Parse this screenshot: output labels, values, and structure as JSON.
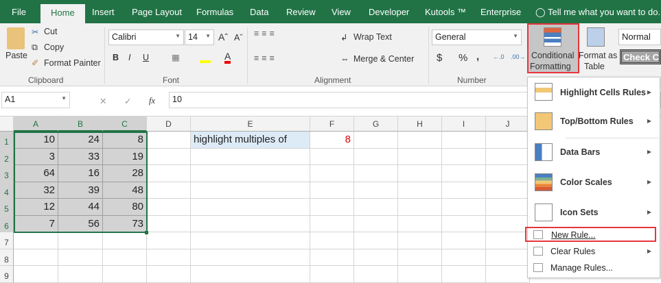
{
  "tabs": [
    "File",
    "Home",
    "Insert",
    "Page Layout",
    "Formulas",
    "Data",
    "Review",
    "View",
    "Developer",
    "Kutools ™",
    "Enterprise"
  ],
  "tell_me": "Tell me what you want to do...",
  "clipboard": {
    "paste": "Paste",
    "cut": "Cut",
    "copy": "Copy",
    "format_painter": "Format Painter",
    "label": "Clipboard"
  },
  "font": {
    "name": "Calibri",
    "size": "14",
    "bold": "B",
    "italic": "I",
    "underline": "U",
    "label": "Font"
  },
  "alignment": {
    "wrap": "Wrap Text",
    "merge": "Merge & Center",
    "label": "Alignment"
  },
  "number": {
    "format": "General",
    "currency": "$",
    "percent": "%",
    "comma": ",",
    "label": "Number"
  },
  "styles": {
    "cf1": "Conditional",
    "cf2": "Formatting",
    "fat1": "Format as",
    "fat2": "Table",
    "normal": "Normal",
    "check": "Check Ce"
  },
  "formula_bar": {
    "name_box": "A1",
    "fx": "fx",
    "value": "10"
  },
  "columns": [
    "A",
    "B",
    "C",
    "D",
    "E",
    "F",
    "G",
    "H",
    "I",
    "J"
  ],
  "rows": [
    "1",
    "2",
    "3",
    "4",
    "5",
    "6",
    "7",
    "8",
    "9"
  ],
  "cells": [
    [
      "10",
      "24",
      "8"
    ],
    [
      "3",
      "33",
      "19"
    ],
    [
      "64",
      "16",
      "28"
    ],
    [
      "32",
      "39",
      "48"
    ],
    [
      "12",
      "44",
      "80"
    ],
    [
      "7",
      "56",
      "73"
    ]
  ],
  "e1": "highlight multiples of",
  "f1": "8",
  "menu": {
    "highlight": "Highlight Cells Rules",
    "topbottom": "Top/Bottom Rules",
    "databars": "Data Bars",
    "colorscales": "Color Scales",
    "iconsets": "Icon Sets",
    "newrule": "New Rule...",
    "clearrules": "Clear Rules",
    "managerules": "Manage Rules..."
  },
  "colors": {
    "accent": "#217346",
    "highlight_border": "#e8333b",
    "f1_text": "#e00000"
  }
}
